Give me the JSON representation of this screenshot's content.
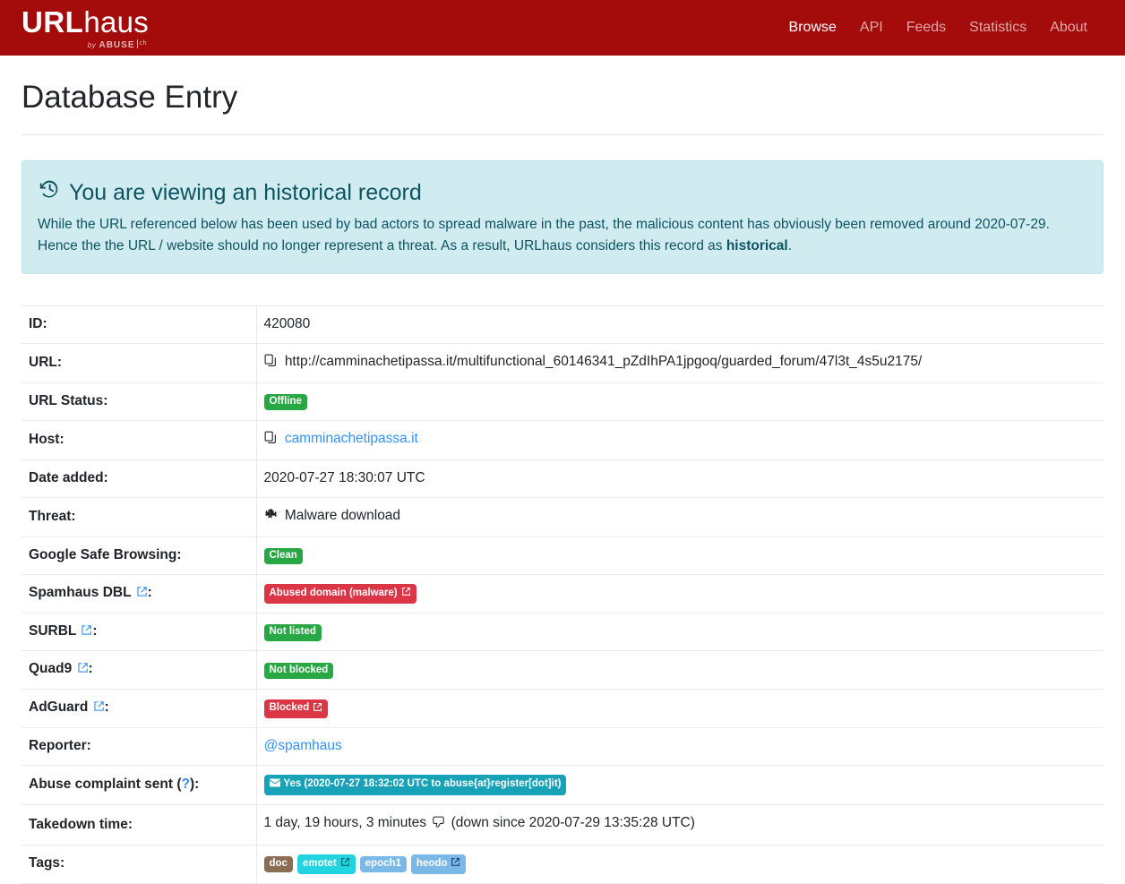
{
  "navbar": {
    "brand": {
      "url_part": "URL",
      "haus_part": "haus",
      "by": "by",
      "abuse": "ABUSE",
      "ch": "ch"
    },
    "links": [
      {
        "label": "Browse",
        "active": true
      },
      {
        "label": "API",
        "active": false
      },
      {
        "label": "Feeds",
        "active": false
      },
      {
        "label": "Statistics",
        "active": false
      },
      {
        "label": "About",
        "active": false
      }
    ]
  },
  "page": {
    "title": "Database Entry"
  },
  "alert": {
    "icon": "history-icon",
    "heading": "You are viewing an historical record",
    "body_part1": "While the URL referenced below has been used by bad actors to spread malware in the past, the malicious content has obviously been removed around 2020-07-29. Hence the the URL / website should no longer represent a threat. As a result, URLhaus considers this record as ",
    "body_bold": "historical",
    "body_part2": "."
  },
  "entry": {
    "id": {
      "key": "ID:",
      "value": "420080"
    },
    "url": {
      "key": "URL:",
      "value": "http://camminachetipassa.it/multifunctional_60146341_pZdIhPA1jpgoq/guarded_forum/47l3t_4s5u2175/",
      "copy_icon": "copy-icon"
    },
    "url_status": {
      "key": "URL Status:",
      "badge": "Offline",
      "badge_color": "#28a745"
    },
    "host": {
      "key": "Host:",
      "value": "camminachetipassa.it",
      "copy_icon": "copy-icon"
    },
    "date_added": {
      "key": "Date added:",
      "value": "2020-07-27 18:30:07 UTC"
    },
    "threat": {
      "key": "Threat:",
      "value": "Malware download",
      "icon": "bug-icon"
    },
    "gsb": {
      "key": "Google Safe Browsing:",
      "badge": "Clean",
      "badge_color": "#28a745"
    },
    "spamhaus": {
      "key": "Spamhaus DBL",
      "key_suffix": ":",
      "badge": "Abused domain (malware)",
      "badge_color": "#dc3545",
      "badge_has_ext_link": true
    },
    "surbl": {
      "key": "SURBL",
      "key_suffix": ":",
      "badge": "Not listed",
      "badge_color": "#28a745",
      "badge_has_ext_link": false
    },
    "quad9": {
      "key": "Quad9",
      "key_suffix": ":",
      "badge": "Not blocked",
      "badge_color": "#28a745",
      "badge_has_ext_link": false
    },
    "adguard": {
      "key": "AdGuard",
      "key_suffix": ":",
      "badge": "Blocked",
      "badge_color": "#dc3545",
      "badge_has_ext_link": true
    },
    "reporter": {
      "key": "Reporter:",
      "value": "@spamhaus"
    },
    "abuse_complaint": {
      "key_prefix": "Abuse complaint sent (",
      "key_help": "?",
      "key_suffix": "):",
      "badge": "Yes (2020-07-27 18:32:02 UTC to abuse{at}register[dot]it)",
      "badge_color": "#17a2b8",
      "badge_icon": "envelope-icon"
    },
    "takedown": {
      "key": "Takedown time:",
      "value_part1": "1 day, 19 hours, 3 minutes",
      "icon": "thumbs-down-icon",
      "value_part2": "(down since 2020-07-29 13:35:28 UTC)"
    },
    "tags": {
      "key": "Tags:",
      "items": [
        {
          "label": "doc",
          "color": "#8a6d53",
          "ext_link": false
        },
        {
          "label": "emotet",
          "color": "#22d3e0",
          "ext_link": true
        },
        {
          "label": "epoch1",
          "color": "#7ab8e8",
          "ext_link": false
        },
        {
          "label": "heodo",
          "color": "#7ab8e8",
          "ext_link": true
        }
      ]
    }
  }
}
